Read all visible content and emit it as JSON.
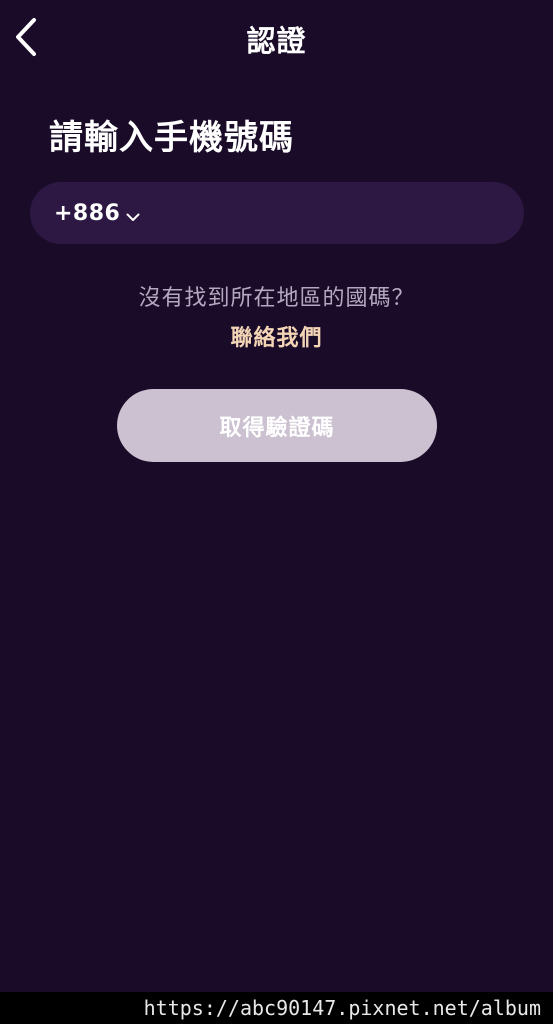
{
  "nav": {
    "title": "認證",
    "back_icon": "chevron-left-icon"
  },
  "heading": "請輸入手機號碼",
  "phone": {
    "country_code": "+886",
    "dropdown_icon": "chevron-down-icon",
    "number": ""
  },
  "help": {
    "text": "沒有找到所在地區的國碼？",
    "link_label": "聯絡我們"
  },
  "submit_label": "取得驗證碼",
  "watermark": "https://abc90147.pixnet.net/album",
  "colors": {
    "background": "#1a0b28",
    "field_background": "#2d1843",
    "link": "#f4d6b7",
    "button": "#cbc1d1",
    "muted_text": "#b4a9c0"
  }
}
